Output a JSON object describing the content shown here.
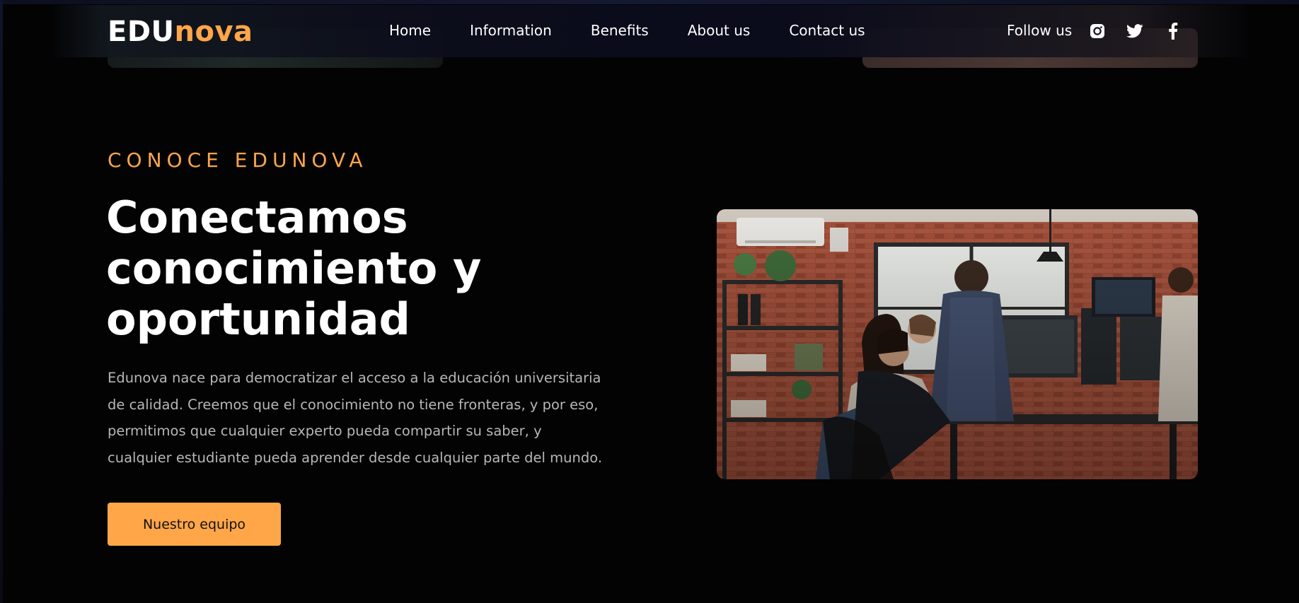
{
  "brand": {
    "part1": "EDU",
    "part2": "nova"
  },
  "nav": {
    "items": [
      {
        "label": "Home"
      },
      {
        "label": "Information"
      },
      {
        "label": "Benefits"
      },
      {
        "label": "About us"
      },
      {
        "label": "Contact us"
      }
    ],
    "follow_label": "Follow us",
    "social_icons": [
      "instagram-icon",
      "twitter-icon",
      "facebook-icon"
    ]
  },
  "hero": {
    "eyebrow": "CONOCE EDUNOVA",
    "headline": [
      "Conectamos",
      "conocimiento y",
      "oportunidad"
    ],
    "paragraph": "Edunova nace para democratizar el acceso a la educación universitaria de calidad. Creemos que el conocimiento no tiene fronteras, y por eso, permitimos que cualquier experto pueda compartir su saber, y cualquier estudiante pueda aprender desde cualquier parte del mundo.",
    "cta_label": "Nuestro equipo"
  },
  "colors": {
    "accent": "#ffa649",
    "background": "#030304",
    "text": "#ffffff",
    "muted_text": "#b7b7b7"
  }
}
